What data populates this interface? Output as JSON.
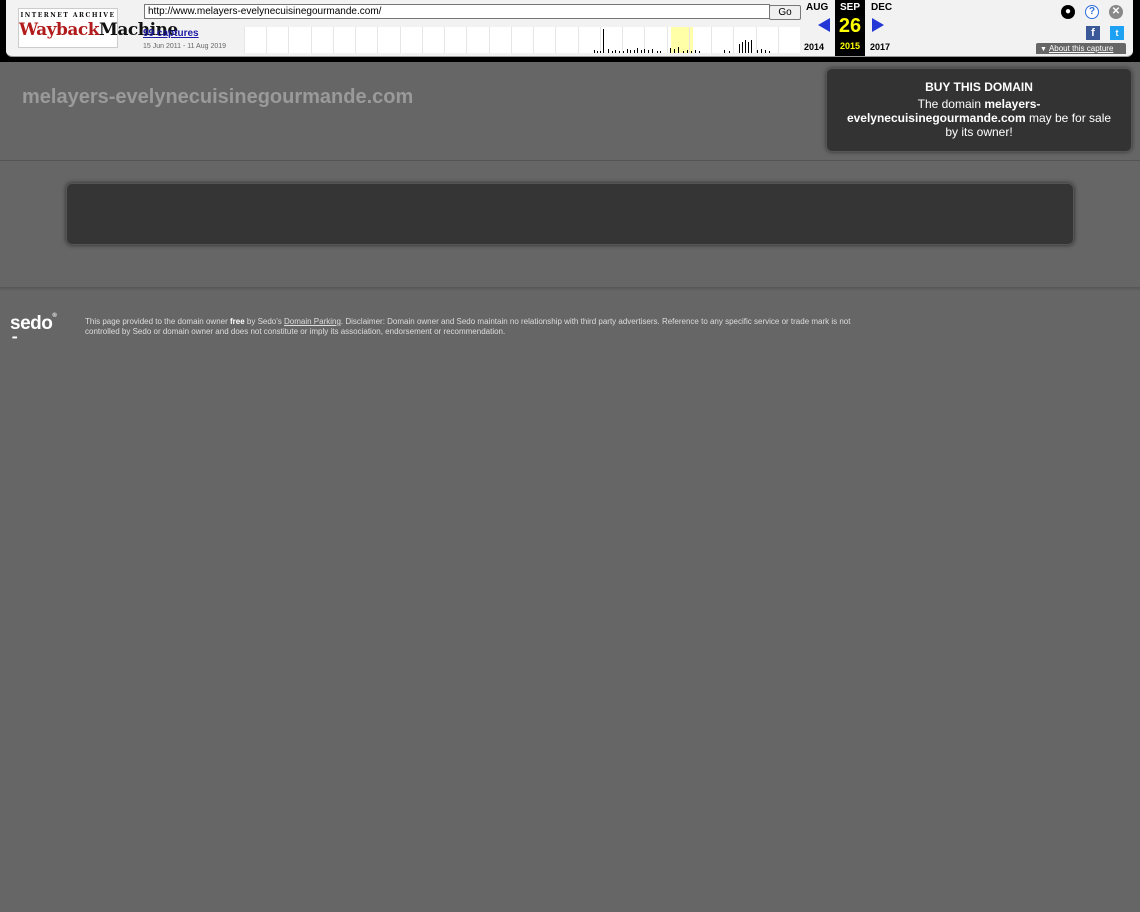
{
  "toolbar": {
    "logo_top": "INTERNET ARCHIVE",
    "logo_wayback": "Wayback",
    "logo_machine": "Machine",
    "url_value": "http://www.melayers-evelynecuisinegourmande.com/",
    "go_label": "Go",
    "captures_label": "99 captures",
    "date_range": "15 Jun 2011 - 11 Aug 2019",
    "prev_month": "AUG",
    "cur_month": "SEP",
    "next_month": "DEC",
    "cur_day": "26",
    "prev_year": "2014",
    "cur_year": "2015",
    "next_year": "2017",
    "about_label": "About this capture",
    "icons": [
      "user-icon",
      "help-icon",
      "close-icon",
      "facebook-icon",
      "twitter-icon"
    ]
  },
  "page": {
    "domain_title": "melayers-evelynecuisinegourmande.com",
    "buy_title": "BUY THIS DOMAIN",
    "buy_text_prefix": "The domain ",
    "buy_domain": "melayers-evelynecuisinegourmande.com",
    "buy_text_suffix": " may be for sale by its owner!"
  },
  "footer": {
    "sedo_logo": "sedo",
    "disclaimer_1": "This page provided to the domain owner ",
    "disclaimer_free": "free",
    "disclaimer_2": " by Sedo's ",
    "disclaimer_link": "Domain Parking",
    "disclaimer_3": ". Disclaimer: Domain owner and Sedo maintain no relationship with third party advertisers. Reference to any specific service or trade mark is not controlled by Sedo or domain owner and does not constitute or imply its association, endorsement or recommendation."
  },
  "colors": {
    "background": "#666666",
    "accent_arrow": "#2237d6",
    "highlight_day": "#ffff00"
  }
}
